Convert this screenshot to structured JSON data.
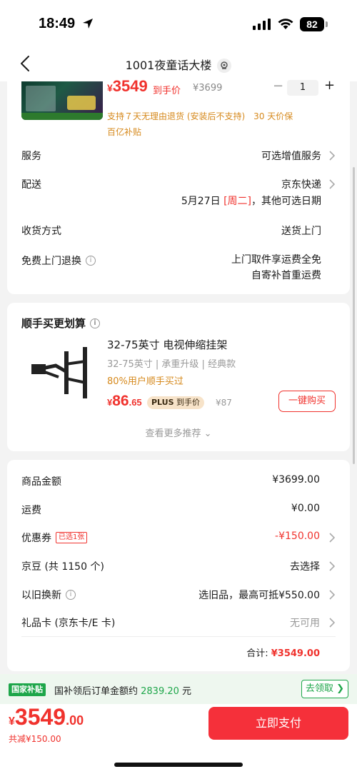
{
  "status_bar": {
    "time": "18:49",
    "battery": "82"
  },
  "nav": {
    "title": "1001夜童话大楼"
  },
  "product": {
    "price_yen": "¥",
    "price": "3549",
    "price_tag": "到手价",
    "original_price": "¥3699",
    "qty_minus": "−",
    "quantity": "1",
    "qty_plus": "+",
    "service_line1": "支持７天无理由退货 (安装后不支持)　30 天价保",
    "service_line2": "百亿补贴"
  },
  "rows": {
    "service": {
      "label": "服务",
      "value": "可选增值服务"
    },
    "delivery": {
      "label": "配送",
      "value": "京东快递",
      "date_prefix": "5月27日 ",
      "date_day": "[周二]",
      "date_suffix": "，其他可选日期"
    },
    "receive": {
      "label": "收货方式",
      "value": "送货上门"
    },
    "return": {
      "label": "免费上门退换",
      "info": "i",
      "value1": "上门取件享运费全免",
      "value2": "自寄补首重运费"
    }
  },
  "buy_together": {
    "title": "顺手买更划算",
    "info": "i",
    "name": "32-75英寸 电视伸缩挂架",
    "spec": "32-75英寸 | 承重升级 | 经典款",
    "promo": "80%用户顺手买过",
    "price_yen": "¥",
    "price_int": "86",
    "price_dec": ".65",
    "plus_label": "PLUS",
    "plus_tag": " 到手价",
    "original_price": "¥87",
    "buy_button": "一键购买",
    "more": "查看更多推荐 ⌄"
  },
  "summary": {
    "goods": {
      "label": "商品金额",
      "value": "¥3699.00"
    },
    "shipping": {
      "label": "运费",
      "value": "¥0.00"
    },
    "coupon": {
      "label": "优惠券",
      "badge": "已选1张",
      "value": "-¥150.00"
    },
    "jingdou": {
      "label": "京豆 (共 1150 个)",
      "value": "去选择"
    },
    "tradein": {
      "label": "以旧换新",
      "info": "i",
      "value": "选旧品，最高可抵¥550.00"
    },
    "giftcard": {
      "label": "礼品卡 (京东卡/E 卡)",
      "value": "无可用"
    },
    "total_label": "合计: ",
    "total_value": "¥3549.00"
  },
  "subsidy": {
    "badge": "国家补贴",
    "text": "国补领后订单金额约 ",
    "amount": "2839.20",
    "unit": " 元",
    "button": "去领取 ❯"
  },
  "bottom": {
    "price_yen": "¥",
    "price_int": "3549",
    "price_dec": ".00",
    "saved": "共减¥150.00",
    "pay_button": "立即支付"
  },
  "colors": {
    "accent_red": "#f0322d",
    "subsidy_green": "#1ea64a",
    "promo_orange": "#d6891c"
  }
}
